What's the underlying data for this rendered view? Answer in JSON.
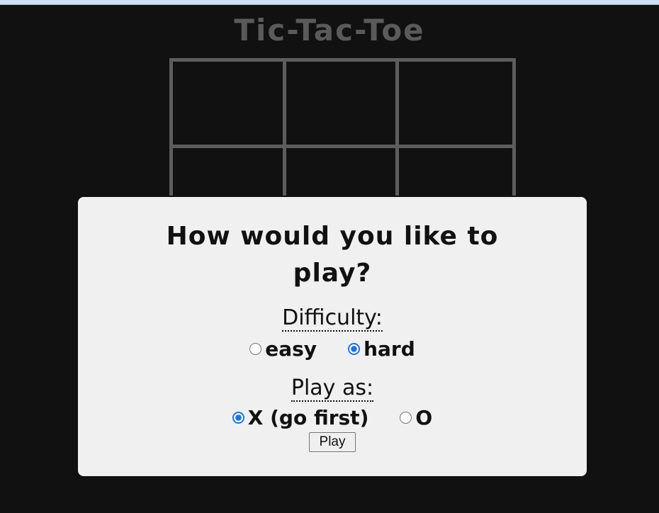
{
  "app": {
    "title": "Tic-Tac-Toe"
  },
  "board": {
    "cells": [
      "",
      "",
      "",
      "",
      "",
      "",
      "",
      "",
      ""
    ]
  },
  "modal": {
    "question": "How would you like to play?",
    "difficulty": {
      "label": "Difficulty:",
      "options": [
        {
          "label": "easy",
          "selected": false
        },
        {
          "label": "hard",
          "selected": true
        }
      ]
    },
    "play_as": {
      "label": "Play as:",
      "options": [
        {
          "label": "X (go first)",
          "selected": true
        },
        {
          "label": "O",
          "selected": false
        }
      ]
    },
    "play_button": "Play"
  },
  "colors": {
    "background": "#111111",
    "grid": "#5d5d5d",
    "modal_bg": "#f0f0f0",
    "radio_accent": "#1a73e8"
  }
}
